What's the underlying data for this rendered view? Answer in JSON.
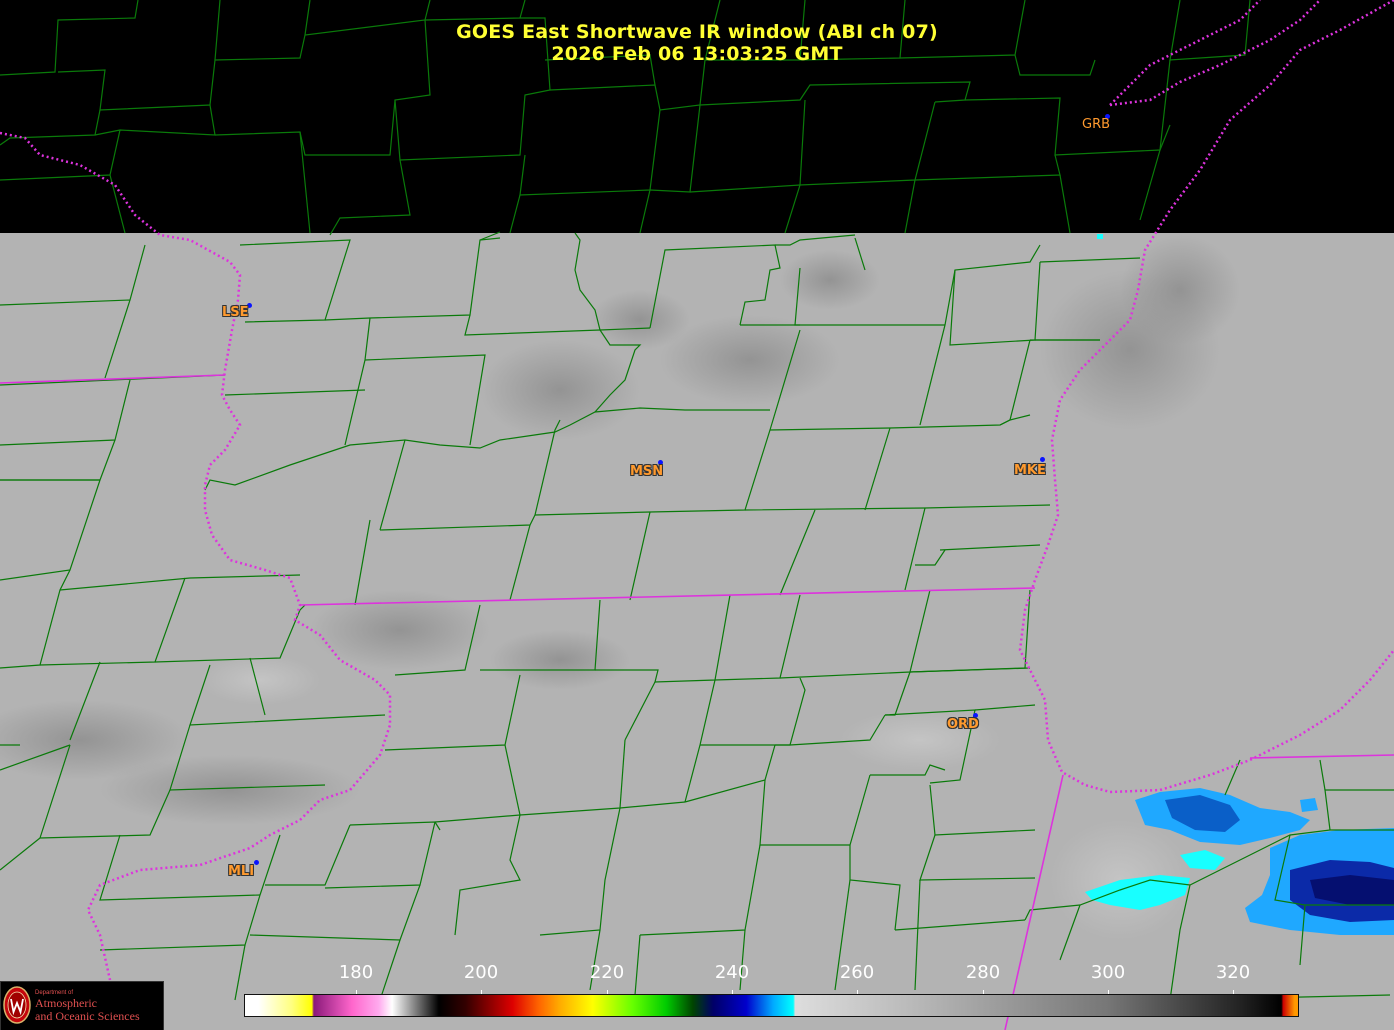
{
  "title": {
    "line1": "GOES East Shortwave IR window (ABI ch 07)",
    "line2": "2026 Feb 06  13:03:25 GMT"
  },
  "stations": [
    {
      "id": "GRB",
      "label": "GRB"
    },
    {
      "id": "LSE",
      "label": "LSE"
    },
    {
      "id": "MSN",
      "label": "MSN"
    },
    {
      "id": "MKE",
      "label": "MKE"
    },
    {
      "id": "ORD",
      "label": "ORD"
    },
    {
      "id": "MLI",
      "label": "MLI"
    }
  ],
  "colorbar": {
    "ticks": [
      "180",
      "200",
      "220",
      "240",
      "260",
      "280",
      "300",
      "320"
    ],
    "stops": [
      {
        "t": 173,
        "color": "#ffffff"
      },
      {
        "t": 178,
        "color": "#ffff80"
      },
      {
        "t": 181,
        "color": "#ffff00"
      },
      {
        "t": 181.3,
        "color": "#8a1a7a"
      },
      {
        "t": 187,
        "color": "#ff66cc"
      },
      {
        "t": 191,
        "color": "#ffaaee"
      },
      {
        "t": 193,
        "color": "#ffffff"
      },
      {
        "t": 200,
        "color": "#000000"
      },
      {
        "t": 204,
        "color": "#330000"
      },
      {
        "t": 211,
        "color": "#dd0000"
      },
      {
        "t": 215,
        "color": "#ff6600"
      },
      {
        "t": 218,
        "color": "#ffaa00"
      },
      {
        "t": 223,
        "color": "#ffff00"
      },
      {
        "t": 229,
        "color": "#66ff00"
      },
      {
        "t": 234,
        "color": "#00cc00"
      },
      {
        "t": 238,
        "color": "#004400"
      },
      {
        "t": 241,
        "color": "#000066"
      },
      {
        "t": 246,
        "color": "#0000cc"
      },
      {
        "t": 250,
        "color": "#00aaff"
      },
      {
        "t": 253,
        "color": "#00ffff"
      },
      {
        "t": 253.3,
        "color": "#dddddd"
      },
      {
        "t": 270,
        "color": "#bbbbbb"
      },
      {
        "t": 300,
        "color": "#777777"
      },
      {
        "t": 320,
        "color": "#222222"
      },
      {
        "t": 326,
        "color": "#000000"
      },
      {
        "t": 326.3,
        "color": "#cc0000"
      },
      {
        "t": 328,
        "color": "#ff9900"
      }
    ]
  },
  "colors": {
    "title": "#ffff33",
    "station_label": "#ff9a2e",
    "station_dot": "#0a14ff",
    "county_lines": "#0a7a0a",
    "state_borders": "#dd33dd",
    "background_cloud_free": "#b3b3b3"
  },
  "logo": {
    "dept": "Department of",
    "name_line1": "Atmospheric",
    "name_line2": "and Oceanic Sciences"
  }
}
